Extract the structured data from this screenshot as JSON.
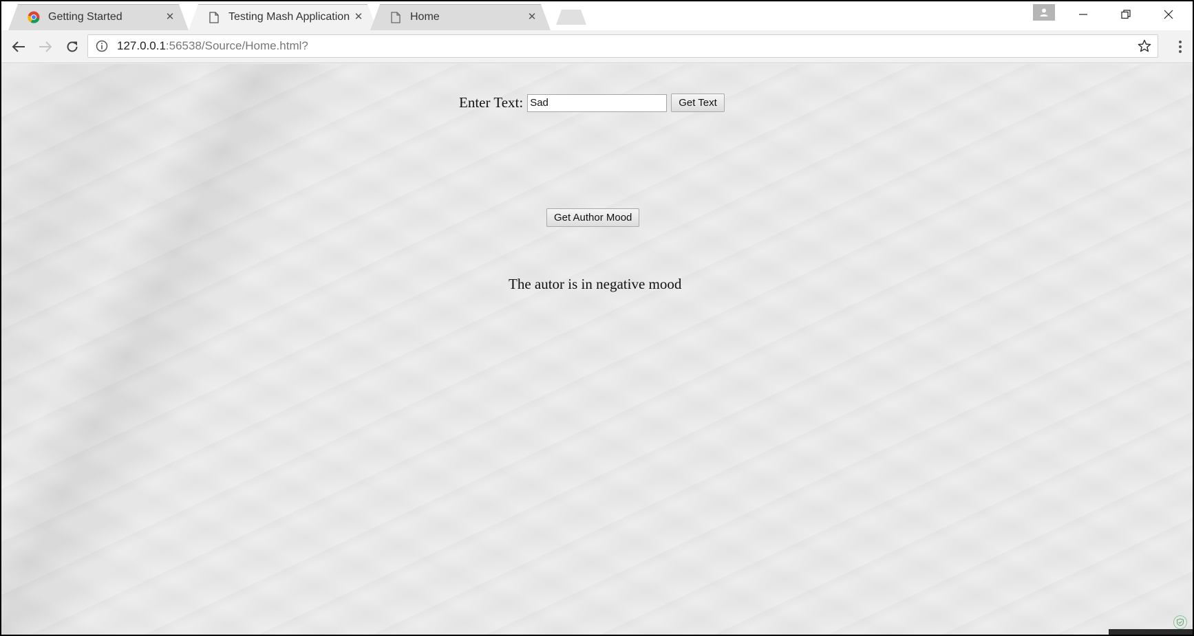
{
  "browser": {
    "tabs": [
      {
        "title": "Getting Started",
        "icon": "chrome-logo-icon",
        "active": false
      },
      {
        "title": "Testing Mash Application",
        "icon": "page-icon",
        "active": true
      },
      {
        "title": "Home",
        "icon": "page-icon",
        "active": false
      }
    ],
    "close_glyph": "✕",
    "address": {
      "host": "127.0.0.1",
      "rest": ":56538/Source/Home.html?"
    }
  },
  "page": {
    "enter_label": "Enter Text:",
    "input_value": "Sad",
    "get_text_label": "Get Text",
    "get_mood_label": "Get Author Mood",
    "result_text": "The autor is in negative mood"
  },
  "colors": {
    "tab_active": "#f2f2f2",
    "tab_inactive": "#dcdcdc",
    "page_bg": "#ececec",
    "badge": "#8fc59b"
  }
}
